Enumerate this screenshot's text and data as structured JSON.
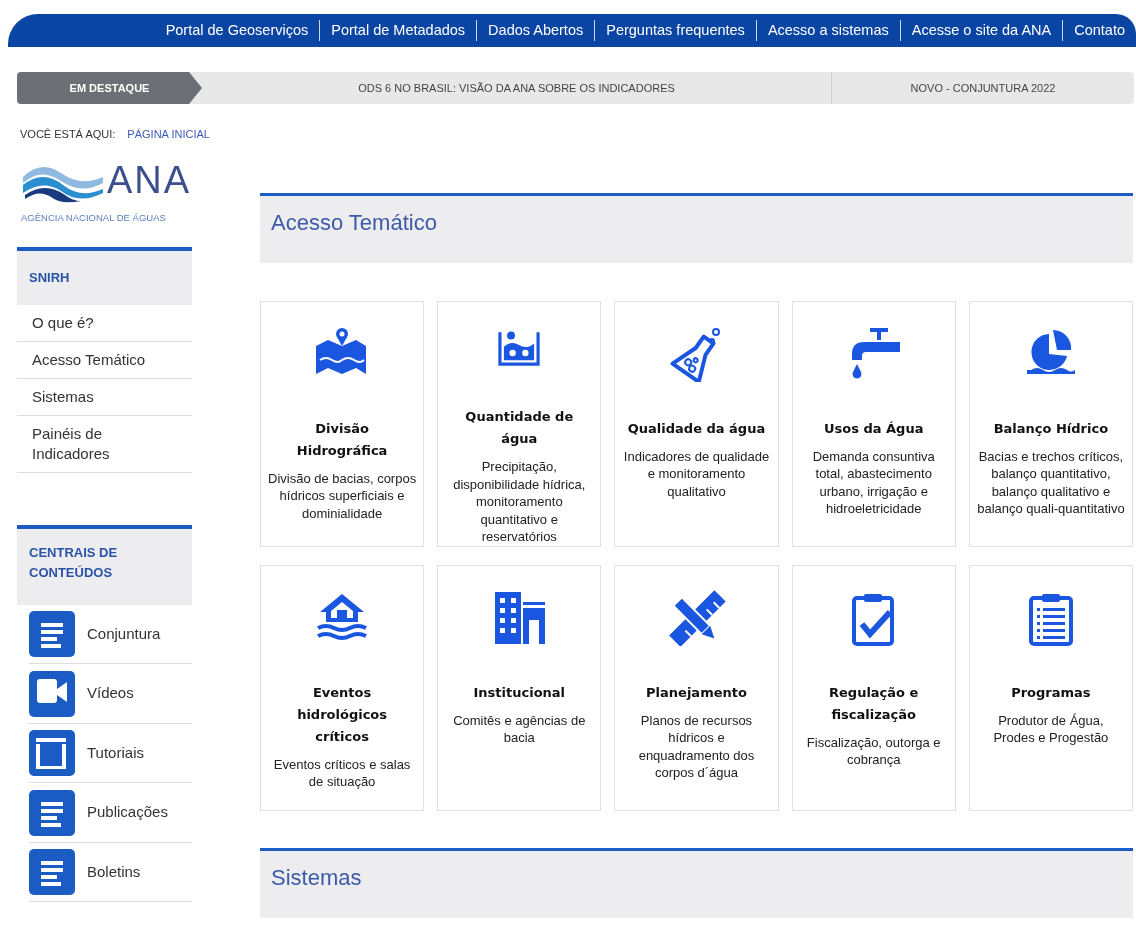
{
  "top_nav": [
    "Portal de Geoserviços",
    "Portal de Metadados",
    "Dados Abertos",
    "Perguntas frequentes",
    "Acesso a sistemas",
    "Acesse o site da ANA",
    "Contato"
  ],
  "highlights": {
    "label": "EM DESTAQUE",
    "items": [
      "ODS 6 NO BRASIL: VISÃO DA ANA SOBRE OS INDICADORES",
      "NOVO - CONJUNTURA 2022"
    ]
  },
  "breadcrumb": {
    "label": "VOCÊ ESTÁ AQUI:",
    "link": "PÁGINA INICIAL"
  },
  "logo": {
    "name": "ANA",
    "subtitle": "AGÊNCIA NACIONAL DE ÁGUAS"
  },
  "sidebar": {
    "snirh": {
      "title": "SNIRH",
      "items": [
        "O que é?",
        "Acesso Temático",
        "Sistemas",
        "Painéis de Indicadores"
      ]
    },
    "centrais": {
      "title": "CENTRAIS DE CONTEÚDOS",
      "items": [
        {
          "label": "Conjuntura",
          "kind": "document"
        },
        {
          "label": "Vídeos",
          "kind": "video"
        },
        {
          "label": "Tutoriais",
          "kind": "layout"
        },
        {
          "label": "Publicações",
          "kind": "document"
        },
        {
          "label": "Boletins",
          "kind": "document"
        }
      ]
    }
  },
  "acesso_tematico": {
    "title": "Acesso Temático",
    "cards": [
      {
        "kind": "map",
        "title": "Divisão Hidrográfica",
        "text": "Divisão de bacias, corpos hídricos superficiais e dominialidade"
      },
      {
        "kind": "tank",
        "title": "Quantidade de água",
        "text": "Precipitação, disponibilidade hídrica, monitoramento quantitativo e reservatórios"
      },
      {
        "kind": "flask",
        "title": "Qualidade da água",
        "text": "Indicadores de qualidade e monitoramento qualitativo"
      },
      {
        "kind": "tap",
        "title": "Usos da Água",
        "text": "Demanda consuntiva total, abastecimento urbano, irrigação e hidroeletricidade"
      },
      {
        "kind": "pie",
        "title": "Balanço Hídrico",
        "text": "Bacias e trechos críticos, balanço quantitativo, balanço qualitativo e balanço quali-quantitativo"
      },
      {
        "kind": "flood",
        "title": "Eventos hidrológicos críticos",
        "text": "Eventos críticos e salas de situação"
      },
      {
        "kind": "building",
        "title": "Institucional",
        "text": "Comitês e agências de bacia"
      },
      {
        "kind": "tools",
        "title": "Planejamento",
        "text": "Planos de recursos hídricos e enquadramento dos corpos d´água"
      },
      {
        "kind": "check",
        "title": "Regulação e fiscalização",
        "text": "Fiscalização, outorga e cobrança"
      },
      {
        "kind": "list",
        "title": "Programas",
        "text": "Produtor de Água, Prodes e Progestão"
      }
    ]
  },
  "sistemas": {
    "title": "Sistemas"
  }
}
